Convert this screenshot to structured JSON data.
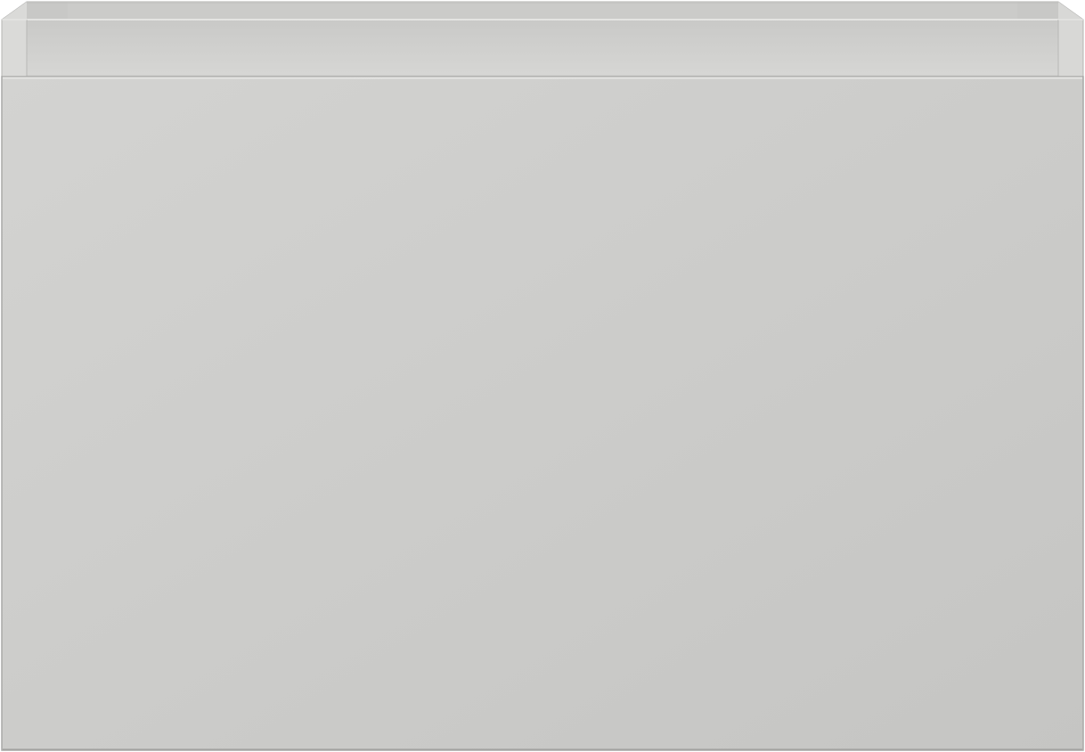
{
  "object": {
    "kind": "cabinet-drawer",
    "colors": {
      "front_light": "#d2d2d0",
      "front_dark": "#c6c6c4",
      "carcass": "#cfcfcd",
      "inner_back": "#d4d4d2",
      "rim_top": "#e0e0de",
      "edge": "#a9a9a7",
      "shadow": "#9a9a98"
    }
  }
}
